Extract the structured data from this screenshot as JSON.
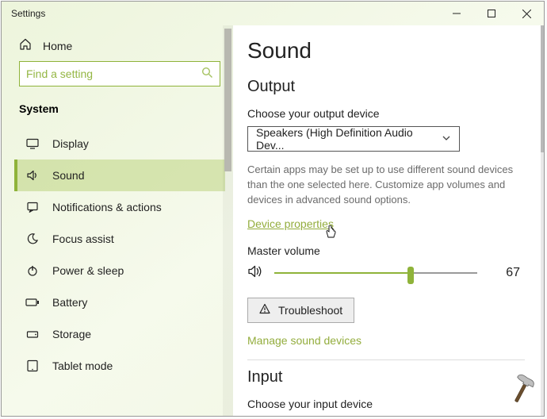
{
  "colors": {
    "accent": "#8fb33a"
  },
  "window": {
    "title": "Settings"
  },
  "sidebar": {
    "home": "Home",
    "search_placeholder": "Find a setting",
    "section": "System",
    "items": [
      {
        "icon": "display-icon",
        "label": "Display"
      },
      {
        "icon": "sound-icon",
        "label": "Sound"
      },
      {
        "icon": "notifications-icon",
        "label": "Notifications & actions"
      },
      {
        "icon": "focus-icon",
        "label": "Focus assist"
      },
      {
        "icon": "power-icon",
        "label": "Power & sleep"
      },
      {
        "icon": "battery-icon",
        "label": "Battery"
      },
      {
        "icon": "storage-icon",
        "label": "Storage"
      },
      {
        "icon": "tablet-icon",
        "label": "Tablet mode"
      }
    ],
    "selected_index": 1
  },
  "main": {
    "title": "Sound",
    "output": {
      "heading": "Output",
      "choose_label": "Choose your output device",
      "device_selected": "Speakers (High Definition Audio Dev...",
      "helper": "Certain apps may be set up to use different sound devices than the one selected here. Customize app volumes and devices in advanced sound options.",
      "device_properties": "Device properties",
      "master_volume_label": "Master volume",
      "volume_value": 67,
      "troubleshoot": "Troubleshoot",
      "manage_link": "Manage sound devices"
    },
    "input": {
      "heading": "Input",
      "choose_label": "Choose your input device"
    }
  }
}
